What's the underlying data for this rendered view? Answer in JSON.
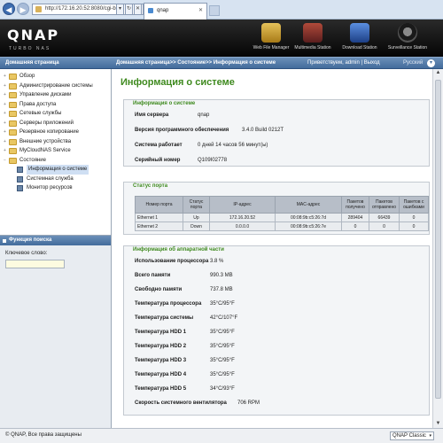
{
  "browser": {
    "back_glyph": "◀",
    "forward_glyph": "▶",
    "url": "http://172.16.20.52:8080/cgi-bin/",
    "url_btn_1": "▾",
    "url_btn_2": "↻",
    "url_btn_3": "✕",
    "tab_title": "qnap",
    "tab_close": "✕"
  },
  "header": {
    "logo": "QNAP",
    "logo_sub": "TURBO NAS",
    "stations": [
      {
        "label": "Web File Manager",
        "icon": "folder-globe-icon",
        "color": "#c99a2a"
      },
      {
        "label": "Multimedia Station",
        "icon": "film-icon",
        "color": "#7a2c2c"
      },
      {
        "label": "Download Station",
        "icon": "download-icon",
        "color": "#2d5aa6"
      },
      {
        "label": "Surveillance Station",
        "icon": "camera-icon",
        "color": "#3a3a3a"
      }
    ]
  },
  "banner": {
    "left": "Домашняя страница",
    "breadcrumb": "Домашняя страница>> Состояние>> Информация о системе",
    "welcome": "Приветствуем, admin | Выход",
    "language": "Русский",
    "lang_arrow": "▾"
  },
  "sidebar": {
    "items": [
      {
        "label": "Обзор",
        "level": 0
      },
      {
        "label": "Администрирование системы",
        "level": 0
      },
      {
        "label": "Управление дисками",
        "level": 0
      },
      {
        "label": "Права доступа",
        "level": 0
      },
      {
        "label": "Сетевые службы",
        "level": 0
      },
      {
        "label": "Серверы приложений",
        "level": 0
      },
      {
        "label": "Резервное копирование",
        "level": 0
      },
      {
        "label": "Внешние устройства",
        "level": 0
      },
      {
        "label": "MyCloudNAS Service",
        "level": 0
      },
      {
        "label": "Состояние",
        "level": 0
      },
      {
        "label": "Информация о системе",
        "level": 1
      },
      {
        "label": "Системная служба",
        "level": 1
      },
      {
        "label": "Монитор ресурсов",
        "level": 1
      }
    ],
    "search": {
      "title": "Функция поиска",
      "keyword_label": "Ключевое слово:",
      "keyword_value": ""
    }
  },
  "main": {
    "title": "Информация о системе",
    "system_info": {
      "heading": "Информация о системе",
      "rows": [
        {
          "key": "Имя сервера",
          "value": "qnap"
        },
        {
          "key": "Версия программного обеспечения",
          "value": "3.4.0 Build 0212T"
        },
        {
          "key": "Система работает",
          "value": "0 дней 14 часов 56 минут(ы)"
        },
        {
          "key": "Серийный номер",
          "value": "Q109I02778"
        }
      ]
    },
    "port_status": {
      "heading": "Статус порта",
      "columns": [
        "Номер порта",
        "Статус порта",
        "IP-адрес",
        "MAC-адрес",
        "Пакетов получено",
        "Пакетов отправлено",
        "Пакетов с ошибками"
      ],
      "rows": [
        [
          "Ethernet 1",
          "Up",
          "172.16.20.52",
          "00:08:9b:c5:26:7d",
          "289404",
          "66439",
          "0"
        ],
        [
          "Ethernet 2",
          "Down",
          "0.0.0.0",
          "00:08:9b:c5:26:7e",
          "0",
          "0",
          "0"
        ]
      ]
    },
    "hardware_info": {
      "heading": "Информация об аппаратной части",
      "rows": [
        {
          "key": "Использование процессора",
          "value": "3.8 %"
        },
        {
          "key": "Всего памяти",
          "value": "990.3 MB"
        },
        {
          "key": "Свободно памяти",
          "value": "737.8 MB"
        },
        {
          "key": "Температура процессора",
          "value": "35°C/95°F"
        },
        {
          "key": "Температура системы",
          "value": "42°C/107°F"
        },
        {
          "key": "Температура HDD 1",
          "value": "35°C/95°F"
        },
        {
          "key": "Температура HDD 2",
          "value": "35°C/95°F"
        },
        {
          "key": "Температура HDD 3",
          "value": "35°C/95°F"
        },
        {
          "key": "Температура HDD 4",
          "value": "35°C/95°F"
        },
        {
          "key": "Температура HDD 5",
          "value": "34°C/93°F"
        },
        {
          "key": "Скорость системного вентилятора",
          "value": "706 RPM"
        }
      ]
    }
  },
  "footer": {
    "copyright": "© QNAP, Все права защищены",
    "theme": "QNAP Classic",
    "theme_arrow": "▾"
  },
  "scroll": {
    "up": "▲",
    "down": "▼"
  }
}
